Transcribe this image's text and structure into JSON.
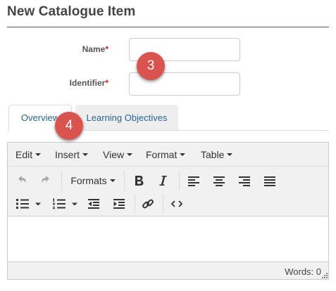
{
  "page": {
    "title": "New Catalogue Item"
  },
  "form": {
    "name_label": "Name",
    "identifier_label": "Identifier",
    "required_marker": "*",
    "name_value": "",
    "identifier_value": ""
  },
  "badges": {
    "step3": "3",
    "step4": "4",
    "color": "#d9534f"
  },
  "tabs": [
    {
      "label": "Overview",
      "active": true
    },
    {
      "label": "Learning Objectives",
      "active": false
    }
  ],
  "editor": {
    "menus": [
      "Edit",
      "Insert",
      "View",
      "Format",
      "Table"
    ],
    "formats_label": "Formats",
    "toolbar_icons": [
      "undo-icon",
      "redo-icon",
      "bold-icon",
      "italic-icon",
      "align-left-icon",
      "align-center-icon",
      "align-right-icon",
      "align-justify-icon",
      "bullet-list-icon",
      "numbered-list-icon",
      "outdent-icon",
      "indent-icon",
      "link-icon",
      "code-icon"
    ],
    "word_count": "Words: 0"
  }
}
